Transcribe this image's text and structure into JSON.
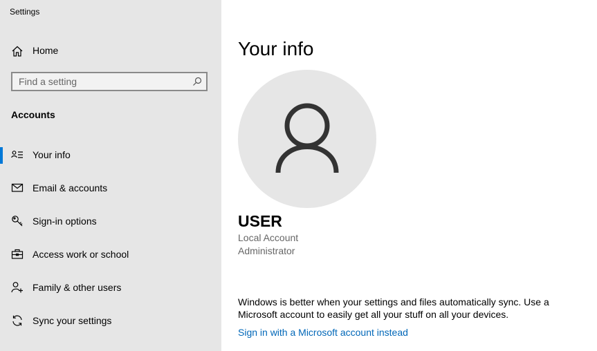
{
  "window": {
    "title": "Settings"
  },
  "sidebar": {
    "home_label": "Home",
    "search_placeholder": "Find a setting",
    "section_heading": "Accounts",
    "items": [
      {
        "label": "Your info",
        "icon": "contact-card-icon",
        "selected": true
      },
      {
        "label": "Email & accounts",
        "icon": "mail-icon",
        "selected": false
      },
      {
        "label": "Sign-in options",
        "icon": "key-icon",
        "selected": false
      },
      {
        "label": "Access work or school",
        "icon": "briefcase-icon",
        "selected": false
      },
      {
        "label": "Family & other users",
        "icon": "person-add-icon",
        "selected": false
      },
      {
        "label": "Sync your settings",
        "icon": "sync-icon",
        "selected": false
      }
    ]
  },
  "main": {
    "title": "Your info",
    "user_name": "USER",
    "account_type": "Local Account",
    "account_role": "Administrator",
    "sync_message": "Windows is better when your settings and files automatically sync. Use a Microsoft account to easily get all your stuff on all your devices.",
    "sign_in_link": "Sign in with a Microsoft account instead"
  },
  "colors": {
    "accent": "#0078d7",
    "link": "#0067b8",
    "sidebar_bg": "#e6e6e6",
    "avatar_bg": "#e6e6e6"
  }
}
